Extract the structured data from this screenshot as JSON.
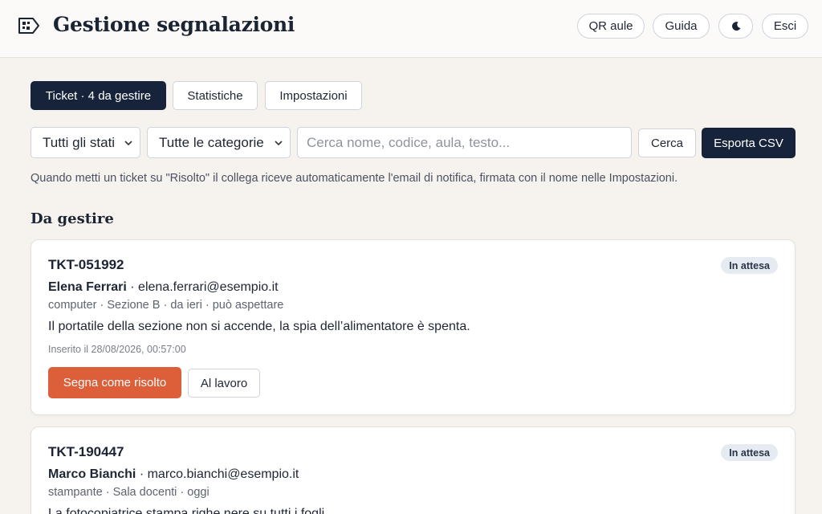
{
  "header": {
    "title": "Gestione segnalazioni",
    "buttons": {
      "qr": "QR aule",
      "guide": "Guida",
      "logout": "Esci"
    }
  },
  "tabs": [
    {
      "label": "Ticket · 4 da gestire",
      "active": true
    },
    {
      "label": "Statistiche",
      "active": false
    },
    {
      "label": "Impostazioni",
      "active": false
    }
  ],
  "filters": {
    "status_selected": "Tutti gli stati",
    "category_selected": "Tutte le categorie",
    "search_placeholder": "Cerca nome, codice, aula, testo...",
    "search_button": "Cerca",
    "export_button": "Esporta CSV"
  },
  "notice": "Quando metti un ticket su \"Risolto\" il collega riceve automaticamente l'email di notifica, firmata con il nome nelle Impostazioni.",
  "section_title": "Da gestire",
  "tickets": [
    {
      "code": "TKT-051992",
      "status": "In attesa",
      "name": "Elena Ferrari",
      "email": "· elena.ferrari@esempio.it",
      "meta": "computer · Sezione B · da ieri · può aspettare",
      "description": "Il portatile della sezione non si accende, la spia dell’alimentatore è spenta.",
      "inserted": "Inserito il 28/08/2026, 00:57:00",
      "resolve_button": "Segna come risolto",
      "work_button": "Al lavoro"
    },
    {
      "code": "TKT-190447",
      "status": "In attesa",
      "name": "Marco Bianchi",
      "email": "· marco.bianchi@esempio.it",
      "meta": "stampante · Sala docenti · oggi",
      "description": "La fotocopiatrice stampa righe nere su tutti i fogli."
    }
  ],
  "colors": {
    "navy": "#16233a",
    "accent": "#dc5f3a",
    "background": "#f6f3ee"
  },
  "icons": {
    "logo": "ticket-qr-icon",
    "theme": "moon-icon",
    "select": "chevron-down-icon"
  }
}
